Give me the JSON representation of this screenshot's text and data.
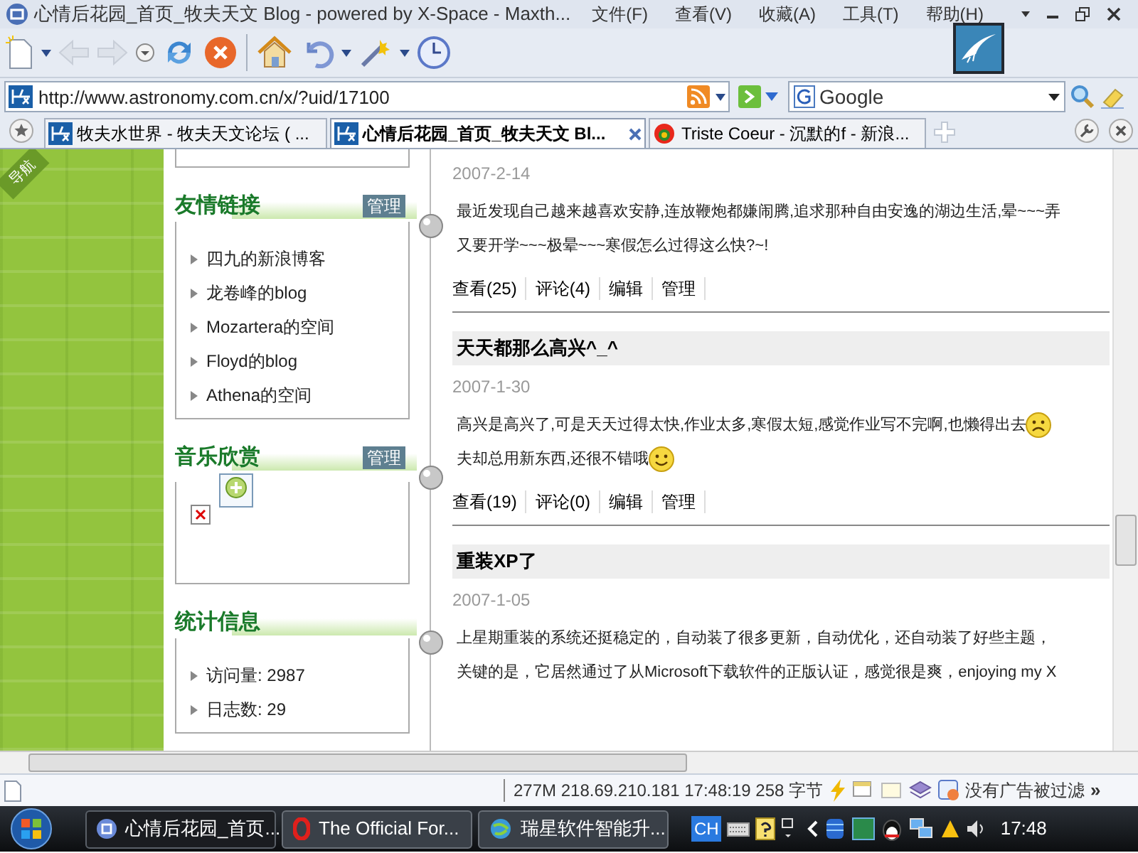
{
  "window": {
    "title": "心情后花园_首页_牧夫天文 Blog - powered by X-Space - Maxth..."
  },
  "menu": [
    "文件(F)",
    "查看(V)",
    "收藏(A)",
    "工具(T)",
    "帮助(H)"
  ],
  "address": {
    "value": "http://www.astronomy.com.cn/x/?uid/17100"
  },
  "search": {
    "engine": "Google"
  },
  "tabs": [
    {
      "label": "牧夫水世界 - 牧夫天文论坛 ( ...",
      "selected": false
    },
    {
      "label": "心情后花园_首页_牧夫天文 Bl...",
      "selected": true
    },
    {
      "label": "Triste Coeur - 沉默的f - 新浪...",
      "selected": false
    }
  ],
  "nav_tab": "导航",
  "sidebar": [
    {
      "kind": "links",
      "title": "友情链接",
      "manage": "管理",
      "items": [
        "四九的新浪博客",
        "龙卷峰的blog",
        "Mozartera的空间",
        "Floyd的blog",
        "Athena的空间"
      ]
    },
    {
      "kind": "player",
      "title": "音乐欣赏",
      "manage": "管理"
    },
    {
      "kind": "links",
      "title": "统计信息",
      "items": [
        "访问量: 2987",
        "日志数: 29"
      ]
    }
  ],
  "posts": [
    {
      "date": "2007-2-14",
      "paragraphs": [
        [
          {
            "kind": "text",
            "text": "最近发现自己越来越喜欢安静,连放鞭炮都嫌闹腾,追求那种自由安逸的湖边生活,晕~~~弄"
          }
        ],
        [
          {
            "kind": "text",
            "text": "又要开学~~~极晕~~~寒假怎么过得这么快?~!"
          }
        ]
      ],
      "actions": [
        "查看(25)",
        "评论(4)",
        "编辑",
        "管理"
      ]
    },
    {
      "title": "天天都那么高兴^_^",
      "date": "2007-1-30",
      "paragraphs": [
        [
          {
            "kind": "text",
            "text": "高兴是高兴了,可是天天过得太快,作业太多,寒假太短,感觉作业写不完啊,也懒得出去"
          },
          {
            "kind": "frown"
          }
        ],
        [
          {
            "kind": "text",
            "text": "夫却总用新东西,还很不错哦"
          },
          {
            "kind": "smile"
          }
        ]
      ],
      "actions": [
        "查看(19)",
        "评论(0)",
        "编辑",
        "管理"
      ]
    },
    {
      "title": "重装XP了",
      "date": "2007-1-05",
      "paragraphs": [
        [
          {
            "kind": "text",
            "text": "上星期重装的系统还挺稳定的，自动装了很多更新，自动优化，还自动装了好些主题，"
          }
        ],
        [
          {
            "kind": "text",
            "text": "关键的是，它居然通过了从Microsoft下载软件的正版认证，感觉很是爽，enjoying my X"
          }
        ]
      ]
    }
  ],
  "status_bar": {
    "text": "277M 218.69.210.181 17:48:19 258 字节",
    "filter": "没有广告被过滤",
    "more": "»"
  },
  "taskbar": {
    "items": [
      {
        "label": "心情后花园_首页...",
        "selected": true
      },
      {
        "label": "The Official For...",
        "selected": false
      },
      {
        "label": "瑞星软件智能升...",
        "selected": false
      }
    ],
    "language": "CH",
    "clock": "17:48"
  }
}
